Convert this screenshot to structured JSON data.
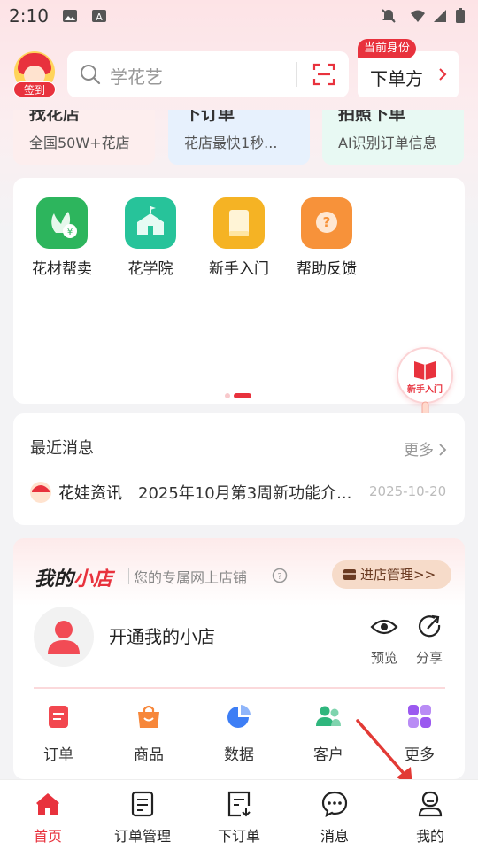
{
  "status_bar": {
    "time": "2:10",
    "icons": [
      "image-icon",
      "a-icon",
      "mute-icon",
      "wifi-icon",
      "signal-icon",
      "battery-icon"
    ]
  },
  "header": {
    "sign_in_badge": "签到",
    "search_placeholder": "学花艺",
    "identity_tag": "当前身份",
    "identity_value": "下单方"
  },
  "feature_cards": [
    {
      "title": "找花店",
      "subtitle": "全国50W+花店",
      "bg": "#fdeeee"
    },
    {
      "title": "下订单",
      "subtitle": "花店最快1秒...",
      "bg": "#e7f1fd"
    },
    {
      "title": "拍照下单",
      "subtitle": "AI识别订单信息",
      "bg": "#e8f9f3"
    }
  ],
  "quick_grid": [
    {
      "label": "花材帮卖",
      "icon": "flower-sell-icon",
      "color": "#2db55d"
    },
    {
      "label": "花学院",
      "icon": "school-icon",
      "color": "#27c39a"
    },
    {
      "label": "新手入门",
      "icon": "book-icon",
      "color": "#f5b324"
    },
    {
      "label": "帮助反馈",
      "icon": "help-icon",
      "color": "#f7923a"
    }
  ],
  "floating_guide": {
    "label": "新手入门"
  },
  "recent_news": {
    "title": "最近消息",
    "more": "更多",
    "item": {
      "source": "花娃资讯",
      "title": "2025年10月第3周新功能介...",
      "date": "2025-10-20"
    }
  },
  "my_shop": {
    "brand_part1": "我的",
    "brand_part2": "小店",
    "slogan": "您的专属网上店铺",
    "manage_button": "进店管理>>",
    "open_label": "开通我的小店",
    "preview_label": "预览",
    "share_label": "分享",
    "tools": [
      {
        "label": "订单",
        "icon": "order-icon",
        "color": "#f2474f"
      },
      {
        "label": "商品",
        "icon": "bag-icon",
        "color": "#f7873a"
      },
      {
        "label": "数据",
        "icon": "pie-chart-icon",
        "color": "#3d7ef5"
      },
      {
        "label": "客户",
        "icon": "customers-icon",
        "color": "#2fb67d"
      },
      {
        "label": "更多",
        "icon": "grid-more-icon",
        "color": "#9b59f0"
      }
    ]
  },
  "bottom_nav": [
    {
      "label": "首页",
      "icon": "home-icon",
      "active": true
    },
    {
      "label": "订单管理",
      "icon": "order-list-icon",
      "active": false
    },
    {
      "label": "下订单",
      "icon": "place-order-icon",
      "active": false
    },
    {
      "label": "消息",
      "icon": "message-icon",
      "active": false
    },
    {
      "label": "我的",
      "icon": "profile-icon",
      "active": false
    }
  ],
  "colors": {
    "accent": "#e8323d",
    "background": "#f3f3f5"
  }
}
